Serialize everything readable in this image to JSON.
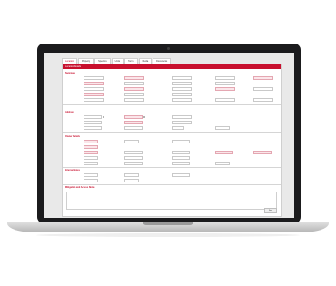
{
  "tabs": [
    "Location",
    "Property",
    "Specifics",
    "Units",
    "Terms",
    "Media",
    "Documents"
  ],
  "active_tab": 0,
  "panel_title": "Location Details",
  "sections": {
    "general": "Summary",
    "address": "Address",
    "details": "Owner Details",
    "contacts": "Internal Notes",
    "notes": "Mitigation and Access Notes"
  },
  "save_label": "Save",
  "colors": {
    "accent": "#c8102e",
    "required_fill": "#fbe6ea"
  }
}
